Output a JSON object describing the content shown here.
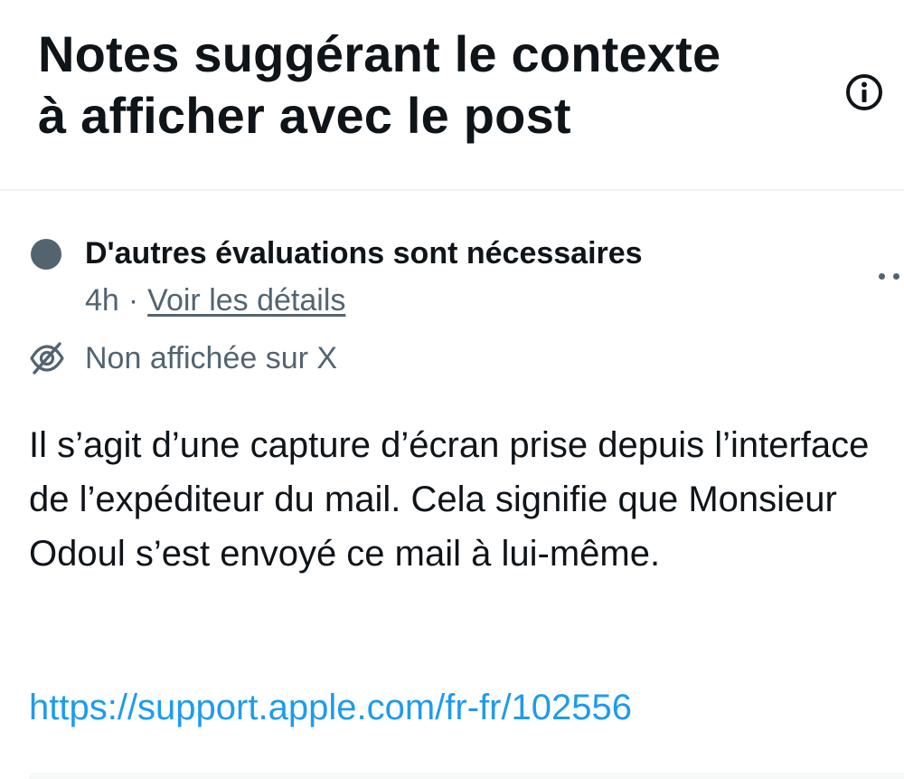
{
  "header": {
    "title_line1": "Notes suggérant le contexte",
    "title_line2": "à afficher avec le post",
    "info_icon": "info-circle-icon"
  },
  "note": {
    "status": "D'autres évaluations sont nécessaires",
    "status_color": "#536471",
    "time": "4h",
    "separator": "·",
    "details_link": "Voir les détails",
    "visibility_icon": "eye-off-icon",
    "visibility": "Non affichée sur X",
    "more_icon": "more-dots-icon",
    "body": "Il s’agit d’une capture d’écran prise depuis l’interface de l’expéditeur du mail. Cela signifie que Monsieur Odoul s’est envoyé ce mail à lui-même.",
    "link": "https://support.apple.com/fr-fr/102556",
    "link_color": "#1d9bf0"
  }
}
